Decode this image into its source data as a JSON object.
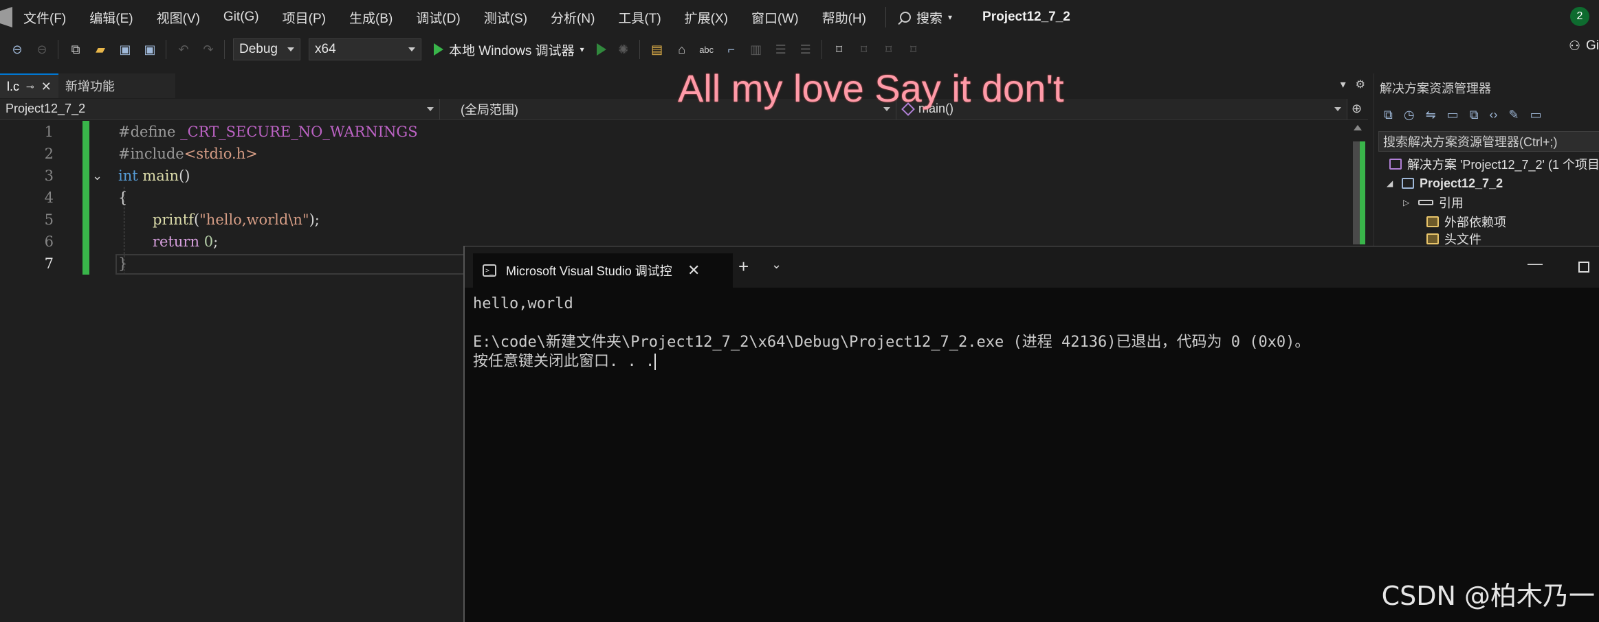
{
  "menubar": {
    "items": [
      "文件(F)",
      "编辑(E)",
      "视图(V)",
      "Git(G)",
      "项目(P)",
      "生成(B)",
      "调试(D)",
      "测试(S)",
      "分析(N)",
      "工具(T)",
      "扩展(X)",
      "窗口(W)",
      "帮助(H)"
    ],
    "search_label": "搜索",
    "project_name": "Project12_7_2",
    "notification_count": "2"
  },
  "toolbar": {
    "configuration": "Debug",
    "platform": "x64",
    "run_label": "本地 Windows 调试器",
    "right_label": "Gi"
  },
  "tabs": {
    "active_label": "l.c",
    "inactive_label": "新增功能"
  },
  "navbar": {
    "project": "Project12_7_2",
    "scope": "(全局范围)",
    "member": "main()"
  },
  "editor": {
    "line_numbers": [
      "1",
      "2",
      "3",
      "4",
      "5",
      "6",
      "7"
    ],
    "line1": {
      "directive": "#define",
      "macro": "_CRT_SECURE_NO_WARNINGS"
    },
    "line2": {
      "directive": "#include",
      "header": "<stdio.h>"
    },
    "line3": {
      "type": "int",
      "name": "main",
      "parens": "()"
    },
    "line4": {
      "brace": "{"
    },
    "line5": {
      "fn": "printf",
      "open": "(",
      "str": "\"hello,world\\n\"",
      "close": ");"
    },
    "line6": {
      "kw": "return",
      "num": "0",
      "semi": ";"
    },
    "line7": {
      "brace": "}"
    }
  },
  "solution_explorer": {
    "title": "解决方案资源管理器",
    "search_placeholder": "搜索解决方案资源管理器(Ctrl+;)",
    "solution_label": "解决方案 'Project12_7_2' (1 个项目",
    "project_label": "Project12_7_2",
    "references_label": "引用",
    "external_deps_label": "外部依赖项",
    "headers_label": "头文件"
  },
  "overlay_text": "All my love Say it don't",
  "console": {
    "tab_title": "Microsoft Visual Studio 调试控",
    "line1": "hello,world",
    "line2": "",
    "line3": "E:\\code\\新建文件夹\\Project12_7_2\\x64\\Debug\\Project12_7_2.exe (进程 42136)已退出，代码为 0 (0x0)。",
    "line4": "按任意键关闭此窗口. . ."
  },
  "watermark": "CSDN @柏木乃一"
}
